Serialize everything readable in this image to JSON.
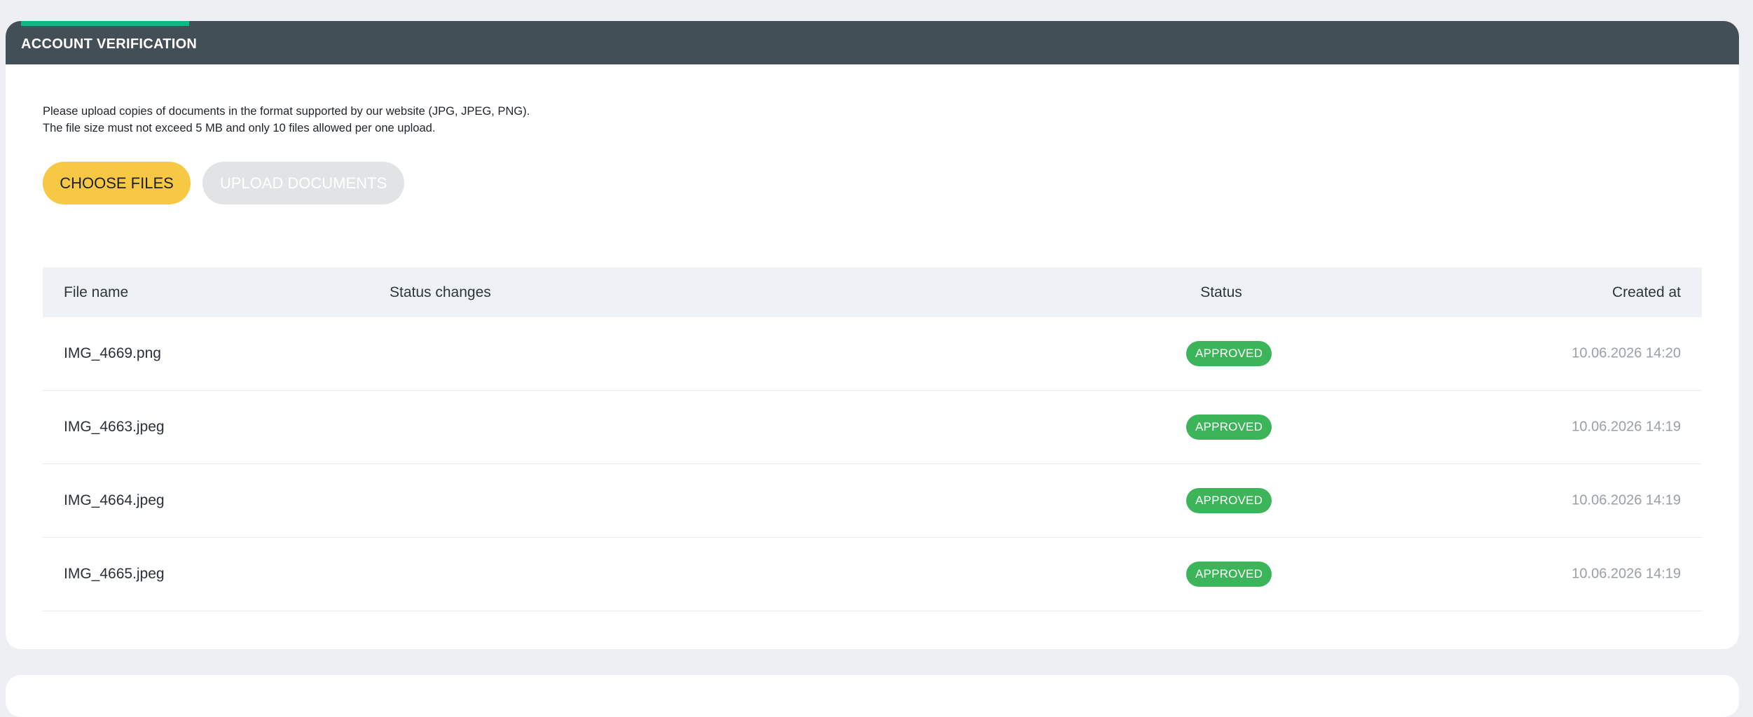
{
  "section": {
    "title": "ACCOUNT VERIFICATION",
    "accent_color": "#14b687",
    "header_color": "#434f57"
  },
  "intro": {
    "line1": "Please upload copies of documents in the format supported by our website (JPG, JPEG, PNG).",
    "line2": "The file size must not exceed 5 MB and only 10 files allowed per one upload."
  },
  "buttons": {
    "choose_files": "CHOOSE FILES",
    "upload_documents": "UPLOAD DOCUMENTS",
    "choose_color": "#f7c843"
  },
  "table": {
    "headers": {
      "file_name": "File name",
      "status_changes": "Status changes",
      "status": "Status",
      "created_at": "Created at"
    },
    "rows": [
      {
        "file_name": "IMG_4669.png",
        "status_changes": "",
        "status": "APPROVED",
        "created_at": "10.06.2026 14:20"
      },
      {
        "file_name": "IMG_4663.jpeg",
        "status_changes": "",
        "status": "APPROVED",
        "created_at": "10.06.2026 14:19"
      },
      {
        "file_name": "IMG_4664.jpeg",
        "status_changes": "",
        "status": "APPROVED",
        "created_at": "10.06.2026 14:19"
      },
      {
        "file_name": "IMG_4665.jpeg",
        "status_changes": "",
        "status": "APPROVED",
        "created_at": "10.06.2026 14:19"
      }
    ],
    "status_color": "#3cb55a"
  }
}
